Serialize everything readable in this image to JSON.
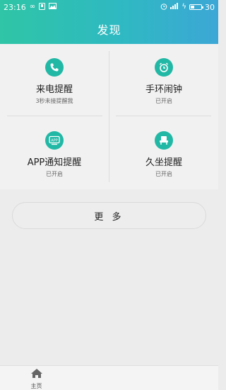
{
  "status_bar": {
    "time": "23:16",
    "battery_level": "30"
  },
  "header": {
    "title": "发现"
  },
  "features": [
    {
      "name": "来电提醒",
      "status": "3秒未接提醒我",
      "icon": "phone-icon"
    },
    {
      "name": "手环闹钟",
      "status": "已开启",
      "icon": "alarm-clock-icon"
    },
    {
      "name": "APP通知提醒",
      "status": "已开启",
      "icon": "app-notification-icon"
    },
    {
      "name": "久坐提醒",
      "status": "已开启",
      "icon": "seat-icon"
    }
  ],
  "more_button": {
    "label": "更 多"
  },
  "tab_bar": {
    "home_label": "主页"
  },
  "colors": {
    "header_start": "#2fc5a6",
    "header_end": "#3ca7d6",
    "icon_bg": "#22b8a6"
  }
}
